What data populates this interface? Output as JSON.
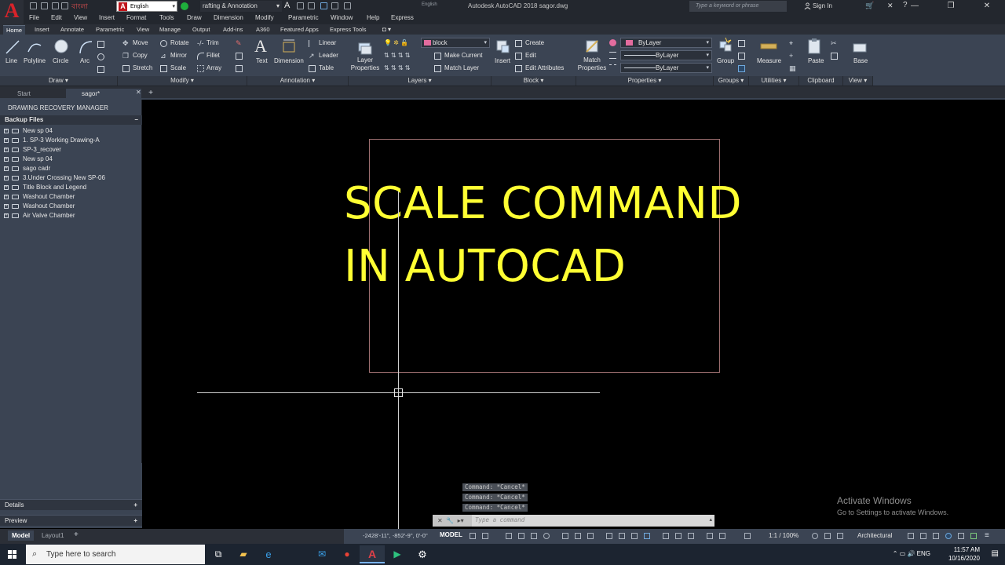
{
  "titlebar": {
    "ime_text": "বাংলা",
    "language": "English",
    "workspace": "rafting & Annotation",
    "english_faint": "English",
    "app_title": "Autodesk AutoCAD 2018   sagor.dwg",
    "search_placeholder": "Type a keyword or phrase",
    "signin": "Sign In"
  },
  "menu": [
    "File",
    "Edit",
    "View",
    "Insert",
    "Format",
    "Tools",
    "Draw",
    "Dimension",
    "Modify",
    "Parametric",
    "Window",
    "Help",
    "Express"
  ],
  "ribbon_tabs": [
    "Home",
    "Insert",
    "Annotate",
    "Parametric",
    "View",
    "Manage",
    "Output",
    "Add-ins",
    "A360",
    "Featured Apps",
    "Express Tools"
  ],
  "ribbon": {
    "draw": {
      "line": "Line",
      "polyline": "Polyline",
      "circle": "Circle",
      "arc": "Arc",
      "title": "Draw"
    },
    "modify": {
      "move": "Move",
      "rotate": "Rotate",
      "trim": "Trim",
      "copy": "Copy",
      "mirror": "Mirror",
      "fillet": "Fillet",
      "stretch": "Stretch",
      "scale": "Scale",
      "array": "Array",
      "title": "Modify"
    },
    "annotation": {
      "text": "Text",
      "dimension": "Dimension",
      "linear": "Linear",
      "leader": "Leader",
      "table": "Table",
      "title": "Annotation"
    },
    "layers": {
      "layer_props_1": "Layer",
      "layer_props_2": "Properties",
      "layer_value": "block",
      "make_current": "Make Current",
      "match_layer": "Match Layer",
      "title": "Layers"
    },
    "block": {
      "insert": "Insert",
      "create": "Create",
      "edit": "Edit",
      "edit_attributes": "Edit Attributes",
      "title": "Block"
    },
    "properties": {
      "match_1": "Match",
      "match_2": "Properties",
      "color": "ByLayer",
      "linetype": "ByLayer",
      "lineweight": "ByLayer",
      "title": "Properties"
    },
    "groups": {
      "group": "Group",
      "title": "Groups"
    },
    "utilities": {
      "measure": "Measure",
      "title": "Utilities"
    },
    "clipboard": {
      "paste": "Paste",
      "title": "Clipboard"
    },
    "view": {
      "base": "Base",
      "title": "View"
    }
  },
  "file_tabs": {
    "start": "Start",
    "active": "sagor*"
  },
  "palette": {
    "title": "DRAWING RECOVERY MANAGER",
    "backup_header": "Backup Files",
    "items": [
      "New sp 04",
      "1. SP-3 Working Drawing-A",
      "SP-3_recover",
      "New sp 04",
      "sago cadr",
      "3.Under Crossing  New SP-06",
      "Title Block and Legend",
      "Washout Chamber",
      "Washout Chamber",
      "Air Valve Chamber"
    ],
    "details": "Details",
    "preview": "Preview"
  },
  "drawing": {
    "line1": "SCALE COMMAND",
    "line2": "IN AUTOCAD",
    "text_color": "#ffff33",
    "rect_color": "#9d6f70"
  },
  "command": {
    "history": [
      "Command: *Cancel*",
      "Command: *Cancel*",
      "Command: *Cancel*"
    ],
    "placeholder": "Type a command"
  },
  "watermark": {
    "line1": "Activate Windows",
    "line2": "Go to Settings to activate Windows."
  },
  "status": {
    "layout_tabs": [
      "Model",
      "Layout1"
    ],
    "coords": "-2428'-11\", -852'-9\", 0'-0\"",
    "model": "MODEL",
    "scale": "1:1 / 100%",
    "units": "Architectural"
  },
  "taskbar": {
    "search_placeholder": "Type here to search",
    "time": "11:57 AM",
    "date": "10/16/2020"
  }
}
